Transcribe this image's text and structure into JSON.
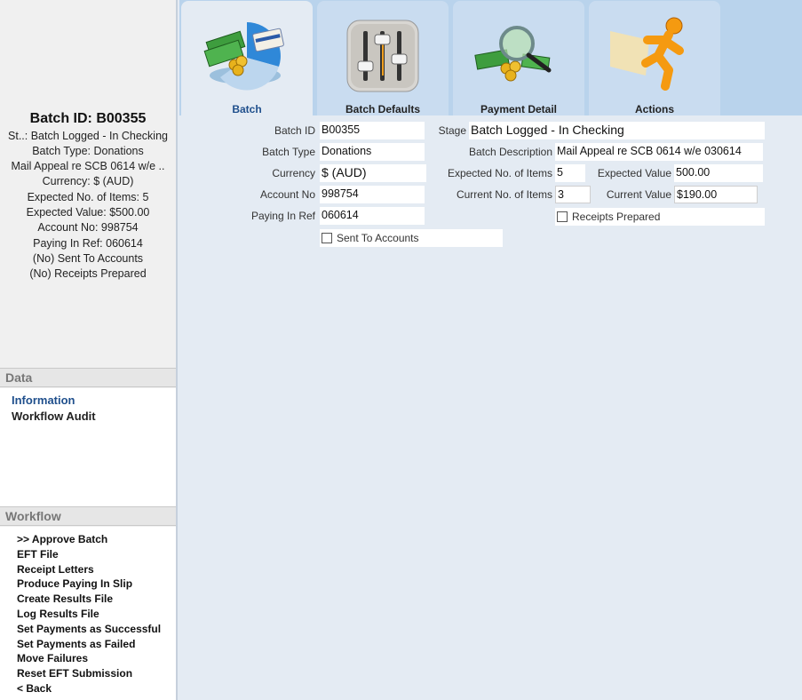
{
  "summary": {
    "title": "Batch ID: B00355",
    "lines": [
      "St..: Batch Logged - In Checking",
      "Batch Type: Donations",
      "Mail Appeal re SCB 0614 w/e ..",
      "Currency: $ (AUD)",
      "Expected No. of Items: 5",
      "Expected Value: $500.00",
      "Account No: 998754",
      "Paying In Ref: 060614",
      "(No) Sent To Accounts",
      "(No) Receipts Prepared"
    ]
  },
  "data_section": {
    "heading": "Data",
    "items": [
      {
        "label": "Information",
        "active": true
      },
      {
        "label": "Workflow Audit",
        "active": false
      }
    ]
  },
  "workflow_section": {
    "heading": "Workflow",
    "items": [
      ">> Approve Batch",
      "EFT File",
      "Receipt Letters",
      "Produce Paying In Slip",
      "Create Results File",
      "Log Results File",
      "Set Payments as Successful",
      "Set Payments as Failed",
      "Move Failures",
      "Reset EFT Submission",
      "< Back"
    ]
  },
  "tabs": [
    {
      "label": "Batch",
      "active": true,
      "icon": "money-chart-icon"
    },
    {
      "label": "Batch Defaults",
      "active": false,
      "icon": "sliders-icon"
    },
    {
      "label": "Payment Detail",
      "active": false,
      "icon": "magnifier-money-icon"
    },
    {
      "label": "Actions",
      "active": false,
      "icon": "running-man-icon"
    }
  ],
  "form": {
    "batch_id": {
      "label": "Batch ID",
      "value": "B00355"
    },
    "batch_type": {
      "label": "Batch Type",
      "value": "Donations"
    },
    "currency": {
      "label": "Currency",
      "value": "$ (AUD)"
    },
    "account_no": {
      "label": "Account No",
      "value": "998754"
    },
    "paying_in_ref": {
      "label": "Paying In Ref",
      "value": "060614"
    },
    "sent_to_accounts": {
      "label": "Sent To Accounts",
      "checked": false
    },
    "stage": {
      "label": "Stage",
      "value": "Batch Logged - In Checking"
    },
    "batch_description": {
      "label": "Batch Description",
      "value": "Mail Appeal re SCB 0614 w/e 030614"
    },
    "expected_items": {
      "label": "Expected No. of Items",
      "value": "5"
    },
    "current_items": {
      "label": "Current No. of Items",
      "value": "3"
    },
    "expected_value": {
      "label": "Expected Value",
      "value": "500.00"
    },
    "current_value": {
      "label": "Current Value",
      "value": "$190.00"
    },
    "receipts_prepared": {
      "label": "Receipts Prepared",
      "checked": false
    }
  },
  "colors": {
    "accent": "#1f4f8c",
    "tab_bar": "#b9d3ec",
    "content_bg": "#e4ebf3"
  }
}
